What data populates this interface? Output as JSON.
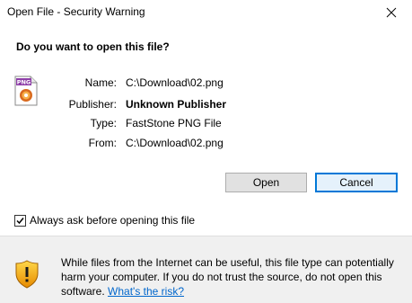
{
  "window": {
    "title": "Open File - Security Warning"
  },
  "question": "Do you want to open this file?",
  "file_icon": {
    "icon": "png-file-icon",
    "badge_text": "PNG"
  },
  "info": {
    "name_label": "Name:",
    "name_value": "C:\\Download\\02.png",
    "publisher_label": "Publisher:",
    "publisher_value": "Unknown Publisher",
    "type_label": "Type:",
    "type_value": "FastStone PNG File",
    "from_label": "From:",
    "from_value": "C:\\Download\\02.png"
  },
  "buttons": {
    "open_label": "Open",
    "cancel_label": "Cancel"
  },
  "checkbox": {
    "label": "Always ask before opening this file",
    "checked": true
  },
  "footer": {
    "warning_text": "While files from the Internet can be useful, this file type can potentially harm your computer. If you do not trust the source, do not open this software.",
    "link_text": "What's the risk?"
  },
  "colors": {
    "accent": "#0078d7",
    "link": "#0066cc",
    "footer_bg": "#f0f0f0",
    "shield_yellow": "#f5c400",
    "shield_orange": "#e68a00"
  }
}
